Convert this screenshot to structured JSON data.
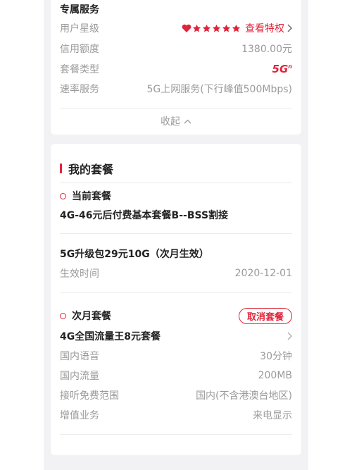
{
  "service": {
    "section_title": "专属服务",
    "star_label": "用户星级",
    "stars": 6,
    "privilege_link": "查看特权",
    "credit_label": "信用额度",
    "credit_value": "1380.00元",
    "plan_type_label": "套餐类型",
    "plan_type_value": "5G",
    "plan_type_sup": "n",
    "speed_label": "速率服务",
    "speed_value": "5G上网服务(下行峰值500Mbps)",
    "collapse_label": "收起"
  },
  "my_plan": {
    "title": "我的套餐",
    "current_head": "当前套餐",
    "current_plan": "4G-46元后付费基本套餐B--BSS割接",
    "upgrade_pack": "5G升级包29元10G（次月生效）",
    "effective_label": "生效时间",
    "effective_value": "2020-12-01",
    "next_head": "次月套餐",
    "cancel_button": "取消套餐",
    "next_plan": "4G全国流量王8元套餐",
    "details": [
      {
        "label": "国内语音",
        "value": "30分钟"
      },
      {
        "label": "国内流量",
        "value": "200MB"
      },
      {
        "label": "接听免费范围",
        "value": "国内(不含港澳台地区)"
      },
      {
        "label": "增值业务",
        "value": "来电显示"
      }
    ]
  },
  "colors": {
    "accent": "#e0243b",
    "page_bg": "#f2f2f4"
  }
}
